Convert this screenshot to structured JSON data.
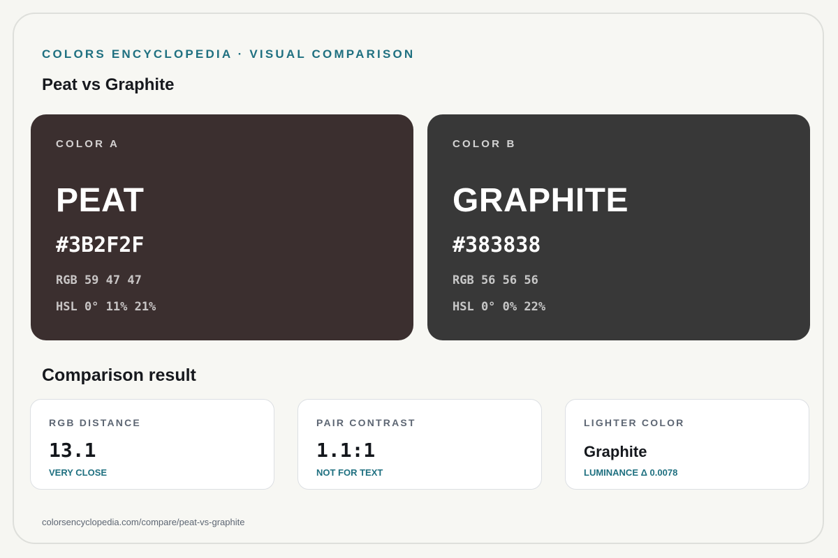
{
  "header": {
    "eyebrow": "COLORS ENCYCLOPEDIA · VISUAL COMPARISON",
    "title": "Peat vs Graphite"
  },
  "colors": {
    "a": {
      "label": "COLOR A",
      "name": "PEAT",
      "hex": "#3B2F2F",
      "rgb": "RGB 59 47 47",
      "hsl": "HSL 0° 11% 21%",
      "swatch_color": "#3B2F2F"
    },
    "b": {
      "label": "COLOR B",
      "name": "GRAPHITE",
      "hex": "#383838",
      "rgb": "RGB 56 56 56",
      "hsl": "HSL 0° 0% 22%",
      "swatch_color": "#383838"
    }
  },
  "comparison": {
    "title": "Comparison result",
    "metrics": [
      {
        "label": "RGB DISTANCE",
        "value": "13.1",
        "note": "VERY CLOSE"
      },
      {
        "label": "PAIR CONTRAST",
        "value": "1.1:1",
        "note": "NOT FOR TEXT"
      },
      {
        "label": "LIGHTER COLOR",
        "value": "Graphite",
        "note": "LUMINANCE Δ 0.0078"
      }
    ]
  },
  "footer": {
    "url": "colorsencyclopedia.com/compare/peat-vs-graphite"
  },
  "theme": {
    "accent": "#1f7080",
    "background": "#f7f7f3",
    "card": "#ffffff"
  }
}
